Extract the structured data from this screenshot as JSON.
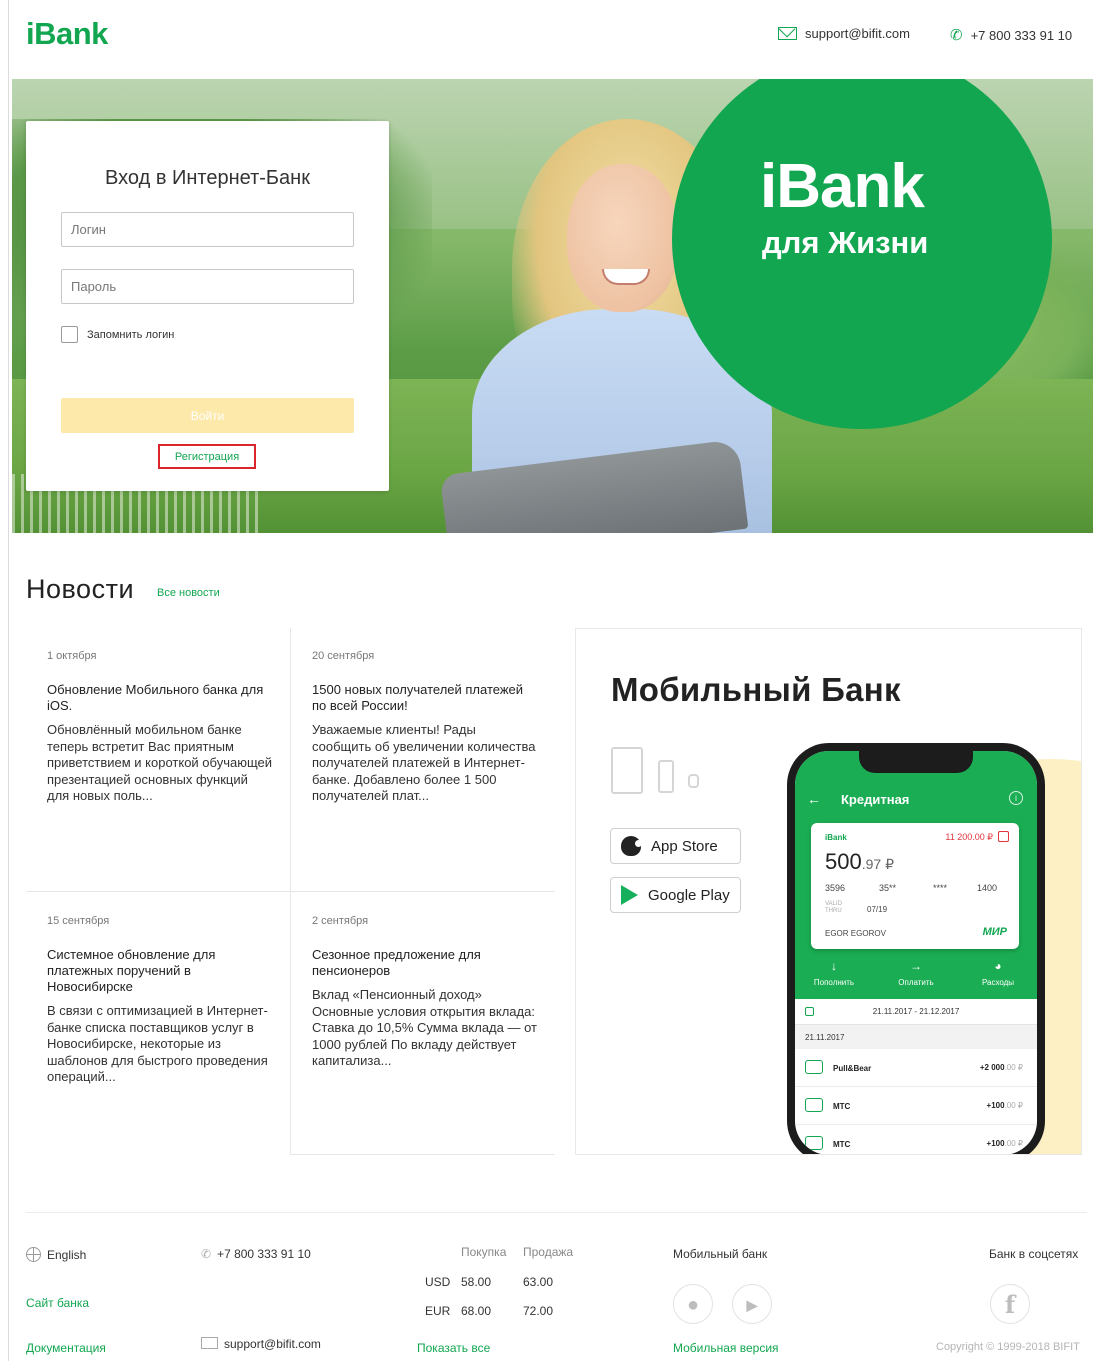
{
  "header": {
    "logo": "iBank",
    "email": "support@bifit.com",
    "phone": "+7 800 333 91 10"
  },
  "hero": {
    "promo_title": "iBank",
    "promo_subtitle": "для Жизни"
  },
  "login": {
    "title": "Вход в Интернет-Банк",
    "login_placeholder": "Логин",
    "password_placeholder": "Пароль",
    "remember_label": "Запомнить логин",
    "submit_label": "Войти",
    "register_label": "Регистрация"
  },
  "news": {
    "heading": "Новости",
    "all_link": "Все новости",
    "items": [
      {
        "date": "1 октября",
        "title": "Обновление Мобильного банка для iOS.",
        "body": "Обновлённый мобильном банке теперь встретит Вас приятным приветствием и короткой обучающей презентацией основных функций для новых поль..."
      },
      {
        "date": "20 сентября",
        "title": "1500 новых получателей платежей по всей России!",
        "body": "Уважаемые клиенты! Рады сообщить об увеличении количества получателей платежей в Интернет-банке. Добавлено более 1 500 получателей плат..."
      },
      {
        "date": "15 сентября",
        "title": "Системное обновление для платежных поручений в Новосибирске",
        "body": "В связи с оптимизацией в Интернет-банке списка поставщиков услуг в Новосибирске, некоторые из шаблонов для быстрого проведения операций..."
      },
      {
        "date": "2 сентября",
        "title": "Сезонное предложение для пенсионеров",
        "body": "Вклад «Пенсионный доход» Основные условия открытия вклада: Ставка до 10,5% Сумма вклада — от 1000 рублей По вкладу действует капитализа..."
      }
    ]
  },
  "mobile_bank": {
    "title": "Мобильный Банк",
    "app_store": "App Store",
    "google_play": "Google Play",
    "phone_screen": {
      "title": "Кредитная",
      "card_brand": "iBank",
      "limit": "11 200.00 ₽",
      "amount_main": "500",
      "amount_fraction": ".97 ₽",
      "card_groups": [
        "3596",
        "35**",
        "****",
        "1400"
      ],
      "valid_label": "VALID THRU",
      "expiry": "07/19",
      "holder": "EGOR EGOROV",
      "payment_system": "МИР",
      "actions": [
        "Пополнить",
        "Оплатить",
        "Расходы"
      ],
      "period": "21.11.2017 - 21.12.2017",
      "day": "21.11.2017",
      "transactions": [
        {
          "name": "Pull&Bear",
          "amount": "+2 000",
          "cents": ".00 ₽"
        },
        {
          "name": "МТС",
          "amount": "+100",
          "cents": ".00 ₽"
        },
        {
          "name": "МТС",
          "amount": "+100",
          "cents": ".00 ₽"
        }
      ]
    }
  },
  "footer": {
    "language": "English",
    "site_link": "Сайт банка",
    "docs_link": "Документация",
    "phone": "+7 800 333 91 10",
    "email": "support@bifit.com",
    "rates": {
      "buy_label": "Покупка",
      "sell_label": "Продажа",
      "rows": [
        {
          "currency": "USD",
          "buy": "58.00",
          "sell": "63.00"
        },
        {
          "currency": "EUR",
          "buy": "68.00",
          "sell": "72.00"
        }
      ],
      "show_all": "Показать все"
    },
    "mobile_label": "Мобильный банк",
    "mobile_version": "Мобильная версия",
    "social_label": "Банк в соцсетях",
    "copyright": "Copyright © 1999-2018 BIFIT"
  },
  "colors": {
    "brand_green": "#12a650",
    "login_button_disabled": "#fde9a9",
    "highlight_red": "#d9252b",
    "promo_yellow": "#fdf0c4"
  }
}
